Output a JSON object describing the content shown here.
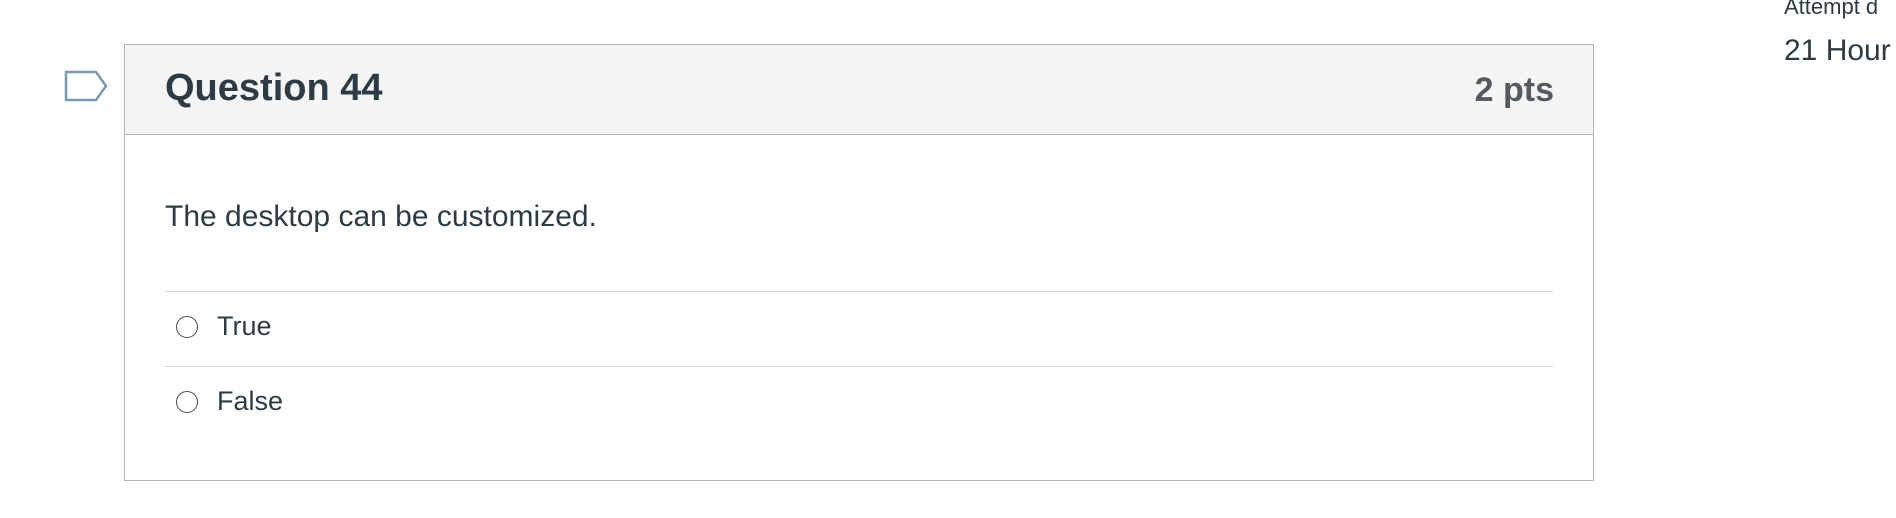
{
  "question": {
    "title": "Question 44",
    "points": "2 pts",
    "text": "The desktop can be customized.",
    "flag_icon": "flag-outline-icon",
    "answers": [
      {
        "label": "True",
        "selected": false
      },
      {
        "label": "False",
        "selected": false
      }
    ]
  },
  "sidebar": {
    "attempt_label": "Attempt d",
    "attempt_time": "21 Hour"
  },
  "colors": {
    "text": "#2d3b45",
    "header_bg": "#f5f5f5",
    "border": "#b4b4b4",
    "flag_stroke": "#7c98b0"
  }
}
